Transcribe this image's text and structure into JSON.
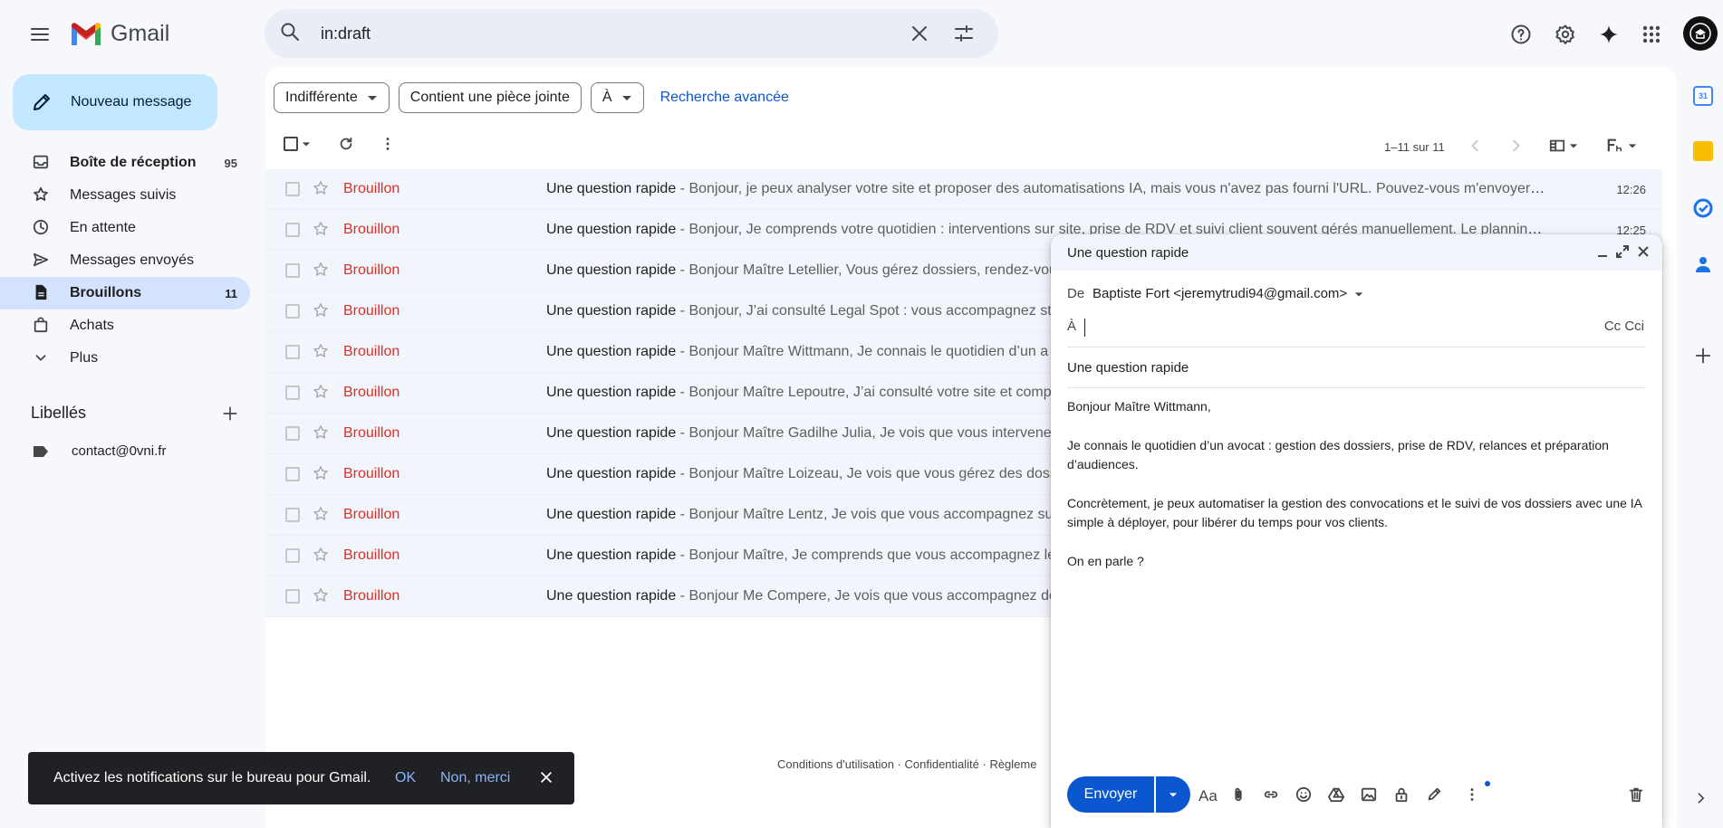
{
  "header": {
    "app_name": "Gmail",
    "search_value": "in:draft"
  },
  "sidebar": {
    "compose_label": "Nouveau message",
    "items": [
      {
        "label": "Boîte de réception",
        "count": "95",
        "icon": "inbox-icon"
      },
      {
        "label": "Messages suivis",
        "count": "",
        "icon": "star-icon"
      },
      {
        "label": "En attente",
        "count": "",
        "icon": "clock-icon"
      },
      {
        "label": "Messages envoyés",
        "count": "",
        "icon": "send-icon"
      },
      {
        "label": "Brouillons",
        "count": "11",
        "icon": "draft-icon"
      },
      {
        "label": "Achats",
        "count": "",
        "icon": "shopping-bag-icon"
      },
      {
        "label": "Plus",
        "count": "",
        "icon": "chevron-down-icon"
      }
    ],
    "labels_title": "Libellés",
    "labels": [
      {
        "label": "contact@0vni.fr"
      }
    ]
  },
  "filters": {
    "chip1": "Indifférente",
    "chip2": "Contient une pièce jointe",
    "chip3": "À",
    "advanced": "Recherche avancée"
  },
  "toolbar": {
    "pager": "1–11 sur 11"
  },
  "emails": [
    {
      "sender": "Brouillon",
      "subject": "Une question rapide",
      "snippet": " - Bonjour, je peux analyser votre site et proposer des automatisations IA, mais vous n'avez pas fourni l'URL. Pouvez-vous m'envoyer le...",
      "time": "12:26"
    },
    {
      "sender": "Brouillon",
      "subject": "Une question rapide",
      "snippet": " - Bonjour, Je comprends votre quotidien : interventions sur site, prise de RDV et suivi client souvent gérés manuellement. Le planning ...",
      "time": "12:25"
    },
    {
      "sender": "Brouillon",
      "subject": "Une question rapide",
      "snippet": " - Bonjour Maître Letellier, Vous gérez dossiers, rendez-vou",
      "time": ""
    },
    {
      "sender": "Brouillon",
      "subject": "Une question rapide",
      "snippet": " - Bonjour, J’ai consulté Legal Spot : vous accompagnez st",
      "time": ""
    },
    {
      "sender": "Brouillon",
      "subject": "Une question rapide",
      "snippet": " - Bonjour Maître Wittmann, Je connais le quotidien d’un a",
      "time": ""
    },
    {
      "sender": "Brouillon",
      "subject": "Une question rapide",
      "snippet": " - Bonjour Maître Lepoutre, J’ai consulté votre site et comp",
      "time": ""
    },
    {
      "sender": "Brouillon",
      "subject": "Une question rapide",
      "snippet": " - Bonjour Maître Gadilhe Julia, Je vois que vous intervene",
      "time": ""
    },
    {
      "sender": "Brouillon",
      "subject": "Une question rapide",
      "snippet": " - Bonjour Maître Loizeau, Je vois que vous gérez des doss",
      "time": ""
    },
    {
      "sender": "Brouillon",
      "subject": "Une question rapide",
      "snippet": " - Bonjour Maître Lentz, Je vois que vous accompagnez su",
      "time": ""
    },
    {
      "sender": "Brouillon",
      "subject": "Une question rapide",
      "snippet": " - Bonjour Maître, Je comprends que vous accompagnez le",
      "time": ""
    },
    {
      "sender": "Brouillon",
      "subject": "Une question rapide",
      "snippet": " - Bonjour Me Compere, Je vois que vous accompagnez de",
      "time": ""
    }
  ],
  "footer": {
    "text": "Conditions d'utilisation · Confidentialité · Règleme"
  },
  "snackbar": {
    "text": "Activez les notifications sur le bureau pour Gmail.",
    "ok": "OK",
    "no": "Non, merci"
  },
  "compose": {
    "title": "Une question rapide",
    "from_label": "De",
    "from_value": "Baptiste Fort <jeremytrudi94@gmail.com>",
    "to_label": "À",
    "cc_label": "Cc Cci",
    "subject": "Une question rapide",
    "body": [
      "Bonjour Maître Wittmann,",
      "Je connais le quotidien d’un avocat : gestion des dossiers, prise de RDV, relances et préparation d’audiences.",
      "Concrètement, je peux automatiser la gestion des convocations et le suivi de vos dossiers avec une IA simple à déployer, pour libérer du temps pour vos clients.",
      "On en parle ?"
    ],
    "send_label": "Envoyer"
  },
  "colors": {
    "accent": "#0b57d0",
    "draft_red": "#d93025",
    "compose_btn": "#c2e7ff",
    "active_nav": "#d3e3fd"
  }
}
